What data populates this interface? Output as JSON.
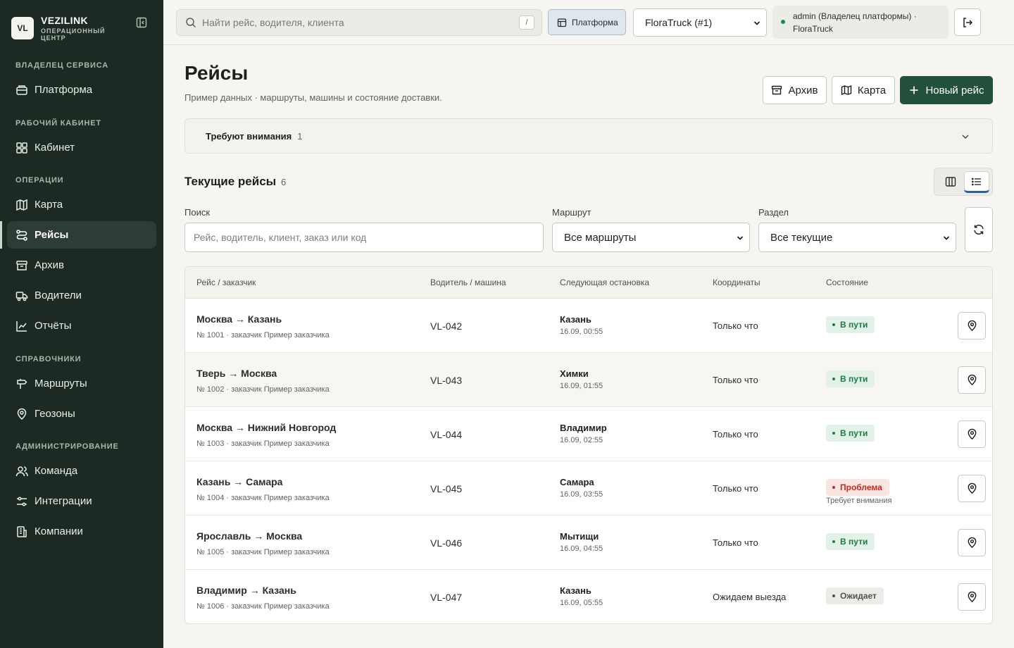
{
  "brand": {
    "logo": "VL",
    "name": "VEZILINK",
    "subtitle": "ОПЕРАЦИОННЫЙ ЦЕНТР"
  },
  "sidebar": {
    "sections": [
      {
        "title": "ВЛАДЕЛЕЦ СЕРВИСА"
      },
      {
        "title": "РАБОЧИЙ КАБИНЕТ"
      },
      {
        "title": "ОПЕРАЦИИ"
      },
      {
        "title": "СПРАВОЧНИКИ"
      },
      {
        "title": "АДМИНИСТРИРОВАНИЕ"
      }
    ],
    "items": [
      {
        "label": "Платформа",
        "icon": "platform-icon"
      },
      {
        "label": "Кабинет",
        "icon": "dashboard-icon"
      },
      {
        "label": "Карта",
        "icon": "map-icon"
      },
      {
        "label": "Рейсы",
        "icon": "routes-icon",
        "active": true
      },
      {
        "label": "Архив",
        "icon": "archive-icon"
      },
      {
        "label": "Водители",
        "icon": "truck-icon"
      },
      {
        "label": "Отчёты",
        "icon": "chart-icon"
      },
      {
        "label": "Маршруты",
        "icon": "signpost-icon"
      },
      {
        "label": "Геозоны",
        "icon": "location-icon"
      },
      {
        "label": "Команда",
        "icon": "users-icon"
      },
      {
        "label": "Интеграции",
        "icon": "sliders-icon"
      },
      {
        "label": "Компании",
        "icon": "building-icon"
      }
    ]
  },
  "topbar": {
    "search_placeholder": "Найти рейс, водителя, клиента",
    "search_shortcut": "/",
    "platform_label": "Платформа",
    "company_select": "FloraTruck (#1)",
    "user_line1": "admin (Владелец платформы) ·",
    "user_line2": "FloraTruck"
  },
  "page": {
    "title": "Рейсы",
    "subtitle": "Пример данных · маршруты, машины и состояние доставки.",
    "buttons": {
      "archive": "Архив",
      "map": "Карта",
      "new_trip": "Новый рейс"
    }
  },
  "attention": {
    "label": "Требуют внимания",
    "count": "1"
  },
  "current": {
    "title": "Текущие рейсы",
    "count": "6"
  },
  "filters": {
    "search_label": "Поиск",
    "search_placeholder": "Рейс, водитель, клиент, заказ или код",
    "route_label": "Маршрут",
    "route_value": "Все маршруты",
    "section_label": "Раздел",
    "section_value": "Все текущие"
  },
  "table": {
    "headers": {
      "trip": "Рейс / заказчик",
      "driver": "Водитель / машина",
      "next_stop": "Следующая остановка",
      "coords": "Координаты",
      "state": "Состояние"
    },
    "rows": [
      {
        "route": "Москва → Казань",
        "meta": "№ 1001 · заказчик Пример заказчика",
        "driver": "VL-042",
        "stop": "Казань",
        "stop_time": "16.09, 00:55",
        "coords": "Только что",
        "status": "В пути",
        "status_kind": "ok",
        "note": ""
      },
      {
        "route": "Тверь → Москва",
        "meta": "№ 1002 · заказчик Пример заказчика",
        "driver": "VL-043",
        "stop": "Химки",
        "stop_time": "16.09, 01:55",
        "coords": "Только что",
        "status": "В пути",
        "status_kind": "ok",
        "note": ""
      },
      {
        "route": "Москва → Нижний Новгород",
        "meta": "№ 1003 · заказчик Пример заказчика",
        "driver": "VL-044",
        "stop": "Владимир",
        "stop_time": "16.09, 02:55",
        "coords": "Только что",
        "status": "В пути",
        "status_kind": "ok",
        "note": ""
      },
      {
        "route": "Казань → Самара",
        "meta": "№ 1004 · заказчик Пример заказчика",
        "driver": "VL-045",
        "stop": "Самара",
        "stop_time": "16.09, 03:55",
        "coords": "Только что",
        "status": "Проблема",
        "status_kind": "bad",
        "note": "Требует внимания"
      },
      {
        "route": "Ярославль → Москва",
        "meta": "№ 1005 · заказчик Пример заказчика",
        "driver": "VL-046",
        "stop": "Мытищи",
        "stop_time": "16.09, 04:55",
        "coords": "Только что",
        "status": "В пути",
        "status_kind": "ok",
        "note": ""
      },
      {
        "route": "Владимир → Казань",
        "meta": "№ 1006 · заказчик Пример заказчика",
        "driver": "VL-047",
        "stop": "Казань",
        "stop_time": "16.09, 05:55",
        "coords": "Ожидаем выезда",
        "status": "Ожидает",
        "status_kind": "wait",
        "note": ""
      }
    ]
  },
  "colors": {
    "sidebar": "#1c2a23",
    "primary": "#23503a",
    "ok": "#1e7a47",
    "danger": "#c42a22"
  }
}
